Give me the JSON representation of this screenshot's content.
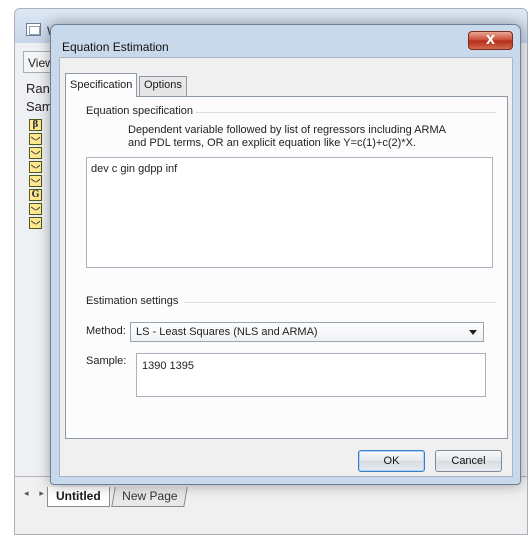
{
  "background_window": {
    "title": "W",
    "toolbar_label": "View",
    "info_lines": [
      "Ran",
      "Sam"
    ],
    "object_icons": [
      {
        "glyph": "β",
        "type": "coef-icon"
      },
      {
        "glyph": "",
        "type": "series-icon"
      },
      {
        "glyph": "",
        "type": "series-icon"
      },
      {
        "glyph": "",
        "type": "series-icon"
      },
      {
        "glyph": "",
        "type": "series-icon"
      },
      {
        "glyph": "G",
        "type": "group-icon"
      },
      {
        "glyph": "",
        "type": "series-icon"
      },
      {
        "glyph": "",
        "type": "series-icon"
      }
    ],
    "nav_arrows": "◂ ▸",
    "tabs": {
      "active": "Untitled",
      "inactive": "New Page"
    }
  },
  "dialog": {
    "title": "Equation Estimation",
    "close_symbol": "X",
    "tabs": {
      "specification": "Specification",
      "options": "Options"
    },
    "equation_spec": {
      "group_label": "Equation specification",
      "hint_line1": "Dependent variable followed by list of regressors including ARMA",
      "hint_line2": "and PDL terms, OR an explicit equation like Y=c(1)+c(2)*X.",
      "value": "dev c gin gdpp inf"
    },
    "estimation_settings": {
      "group_label": "Estimation settings",
      "method_label": "Method:",
      "method_value": "LS  -  Least Squares (NLS and ARMA)",
      "sample_label": "Sample:",
      "sample_value": "1390 1395"
    },
    "buttons": {
      "ok": "OK",
      "cancel": "Cancel"
    }
  },
  "colors": {
    "dialog_frame": "#c9d9ec",
    "close_button": "#c84a33",
    "panel_background": "#fcfcfc"
  }
}
